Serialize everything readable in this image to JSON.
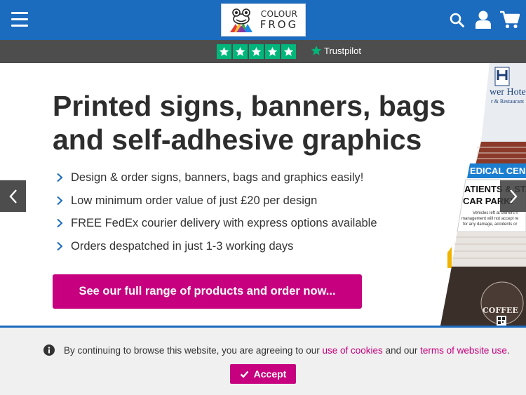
{
  "header": {
    "logo_line1": "COLOUR",
    "logo_line2": "FROG",
    "icons": [
      "menu-icon",
      "search-icon",
      "account-icon",
      "cart-icon"
    ],
    "brand_color": "#1b6bbf"
  },
  "trustbar": {
    "rating_stars": 5,
    "trustpilot_label": "Trustpilot",
    "star_color": "#00b67a"
  },
  "hero": {
    "headline_line1": "Printed signs, banners, bags",
    "headline_line2": "and self-adhesive graphics",
    "bullets": [
      "Design & order signs, banners, bags and graphics easily!",
      "Low minimum order value of just £20 per design",
      "FREE FedEx courier delivery with express options available",
      "Orders despatched in just 1-3 working days"
    ],
    "cta_label": "See our full range of products and order now...",
    "accent_color": "#c6007e"
  },
  "collage": {
    "hotel_text": "wer Hote",
    "hotel_sub": "r & Restaurant",
    "medical_text": "EDICAL CEN",
    "parking_line1": "ATIENTS & STA",
    "parking_line2": "CAR PARKI",
    "notice_line1": "Vehicles left at owners ri",
    "notice_line2": "management will not accept re",
    "notice_line3": "for any damage, accidents or",
    "coffee_text": "COFFEE"
  },
  "cookie": {
    "text_before": "By continuing to browse this website, you are agreeing to our",
    "link1": "use of cookies",
    "text_middle": "and our",
    "link2": "terms of website use",
    "text_end": ".",
    "accept_label": "Accept"
  }
}
